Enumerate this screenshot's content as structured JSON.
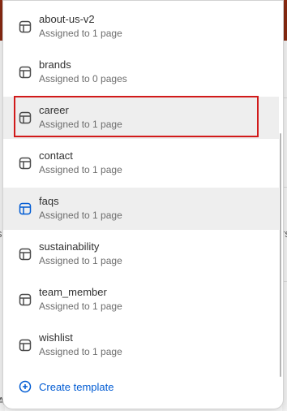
{
  "templates": [
    {
      "name": "about-us-v2",
      "assigned": "Assigned to 1 page",
      "state": "normal"
    },
    {
      "name": "brands",
      "assigned": "Assigned to 0 pages",
      "state": "normal"
    },
    {
      "name": "career",
      "assigned": "Assigned to 1 page",
      "state": "hover"
    },
    {
      "name": "contact",
      "assigned": "Assigned to 1 page",
      "state": "normal"
    },
    {
      "name": "faqs",
      "assigned": "Assigned to 1 page",
      "state": "selected"
    },
    {
      "name": "sustainability",
      "assigned": "Assigned to 1 page",
      "state": "normal"
    },
    {
      "name": "team_member",
      "assigned": "Assigned to 1 page",
      "state": "normal"
    },
    {
      "name": "wishlist",
      "assigned": "Assigned to 1 page",
      "state": "normal"
    }
  ],
  "create_template": {
    "label": "Create template",
    "icon": "plus-circle-icon"
  },
  "icons": {
    "template": "template-layout-icon"
  },
  "colors": {
    "text": "#303030",
    "subtext": "#6d6d6d",
    "link": "#005bd3",
    "icon_default": "#4a4a4a",
    "icon_selected": "#005bd3",
    "active_row_bg": "#eeeeee",
    "highlight_outline": "#d11a1a",
    "header_bar": "#8a2a12"
  },
  "background_fragments": {
    "left_glyph_1": "s",
    "right_glyph_1": "rs",
    "left_glyph_2": "A"
  }
}
